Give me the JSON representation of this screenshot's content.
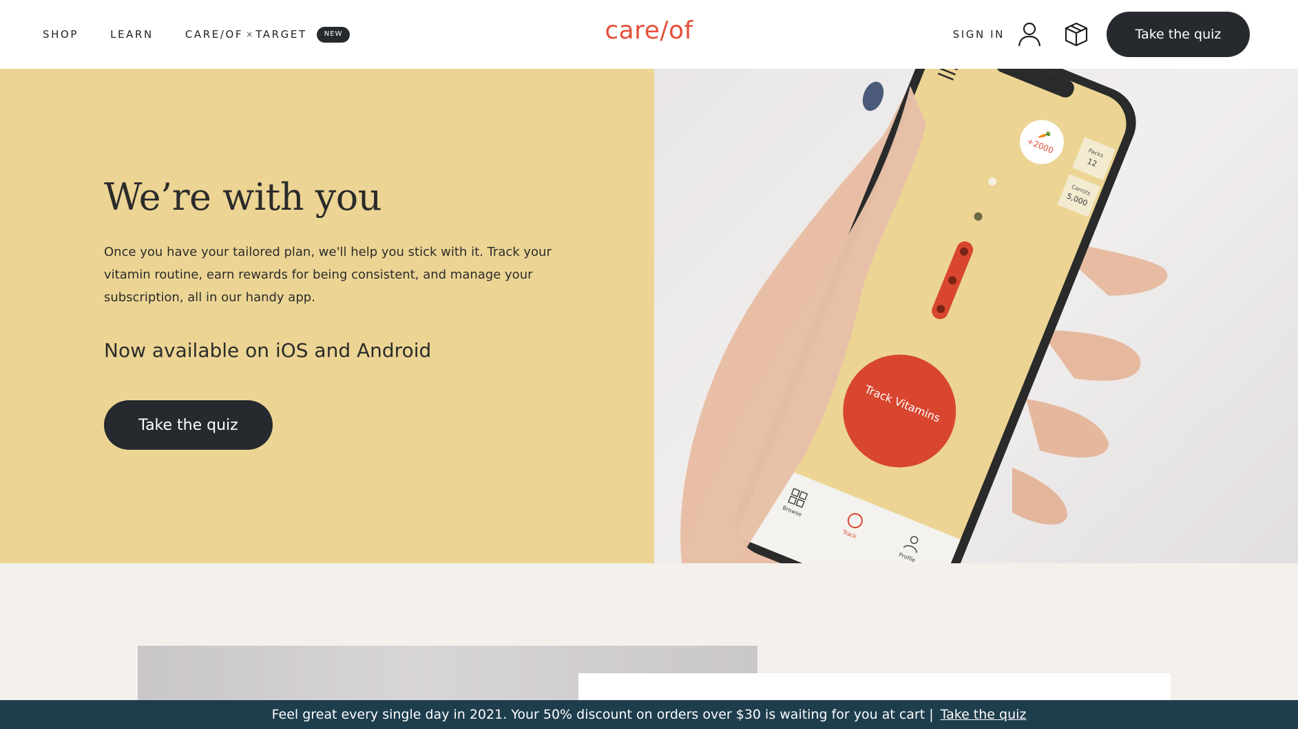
{
  "header": {
    "nav": [
      {
        "label": "SHOP"
      },
      {
        "label": "LEARN"
      }
    ],
    "collab": {
      "left": "CARE/OF",
      "x": "×",
      "right": "TARGET",
      "badge": "NEW"
    },
    "logo": "care/of",
    "sign_in": "SIGN IN",
    "user_icon": "user-icon",
    "box_icon": "package-box-icon",
    "cta": "Take the quiz"
  },
  "hero": {
    "title": "We’re with you",
    "body": "Once you have your tailored plan, we'll help you stick with it. Track your vitamin routine, earn rewards for being consistent, and manage your subscription, all in our handy app.",
    "subtitle": "Now available on iOS and Android",
    "cta": "Take the quiz",
    "phone": {
      "reward": "+2000",
      "packs_label": "Packs",
      "packs_value": "12",
      "carrots_label": "Carrots",
      "carrots_value": "5,000",
      "track_button": "Track Vitamins",
      "tabs": [
        "Browse",
        "Track",
        "Profile"
      ]
    }
  },
  "promo": {
    "text": "Feel great every single day in 2021. Your 50% discount on orders over $30 is waiting for you at cart |",
    "link": "Take the quiz"
  },
  "colors": {
    "brand": "#e4503a",
    "hero_bg": "#ecd594",
    "dark": "#262a2f",
    "promo_bg": "#1e3d4d",
    "page_bg": "#f4f0eb"
  }
}
